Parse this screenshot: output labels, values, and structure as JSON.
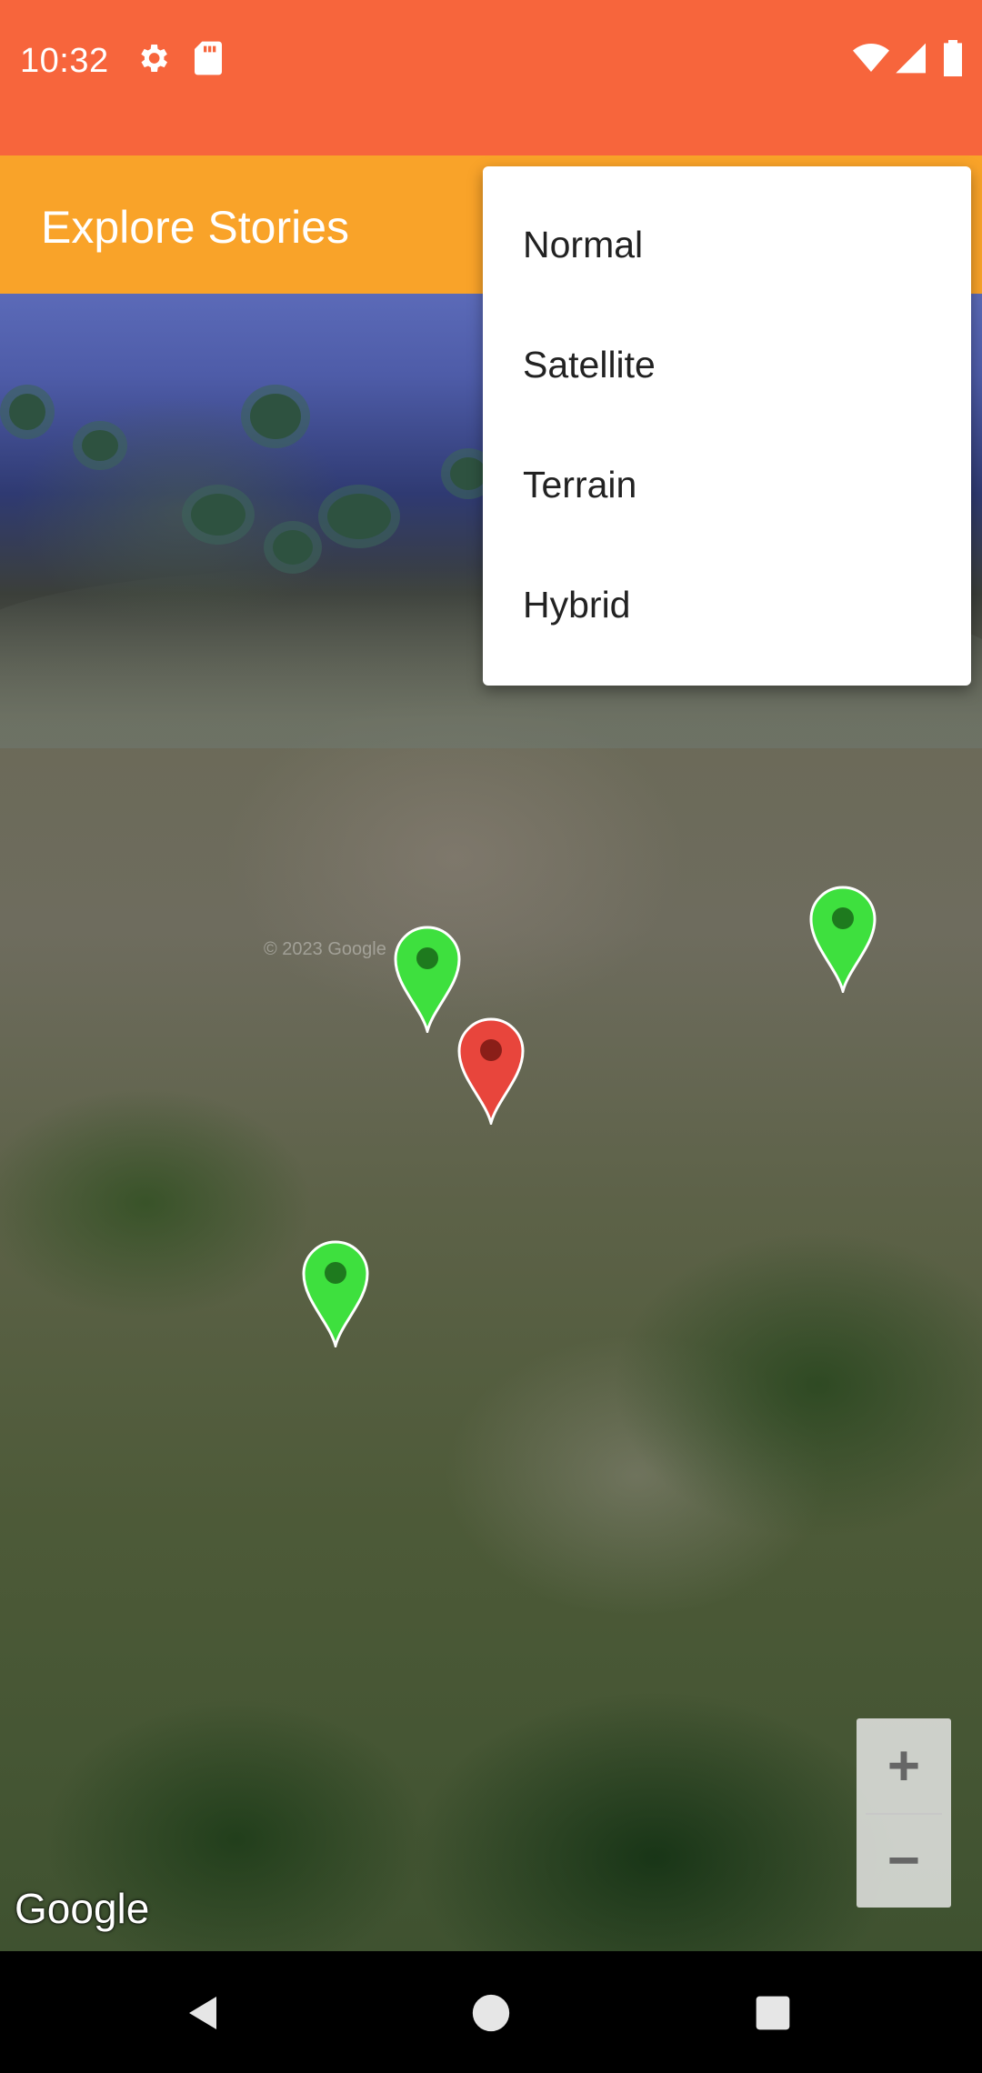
{
  "status_bar": {
    "time": "10:32",
    "icons": [
      "settings-icon",
      "sd-card-icon",
      "wifi-icon",
      "cell-signal-icon",
      "battery-icon"
    ],
    "background": "#F7653C"
  },
  "app_bar": {
    "title": "Explore Stories",
    "background": "#F9A329"
  },
  "map_type_menu": {
    "items": [
      {
        "label": "Normal"
      },
      {
        "label": "Satellite"
      },
      {
        "label": "Terrain"
      },
      {
        "label": "Hybrid"
      }
    ]
  },
  "map": {
    "type": "satellite",
    "copyright": "© 2023 Google",
    "logo": "Google",
    "markers": [
      {
        "color": "#3EE03E",
        "name": "story-marker-1"
      },
      {
        "color": "#E8453C",
        "name": "story-marker-selected"
      },
      {
        "color": "#3EE03E",
        "name": "story-marker-2"
      },
      {
        "color": "#3EE03E",
        "name": "story-marker-3"
      }
    ],
    "zoom_in_symbol": "+",
    "zoom_out_symbol": "−"
  },
  "nav_bar": {
    "icons": [
      "back-icon",
      "home-icon",
      "recents-icon"
    ]
  }
}
